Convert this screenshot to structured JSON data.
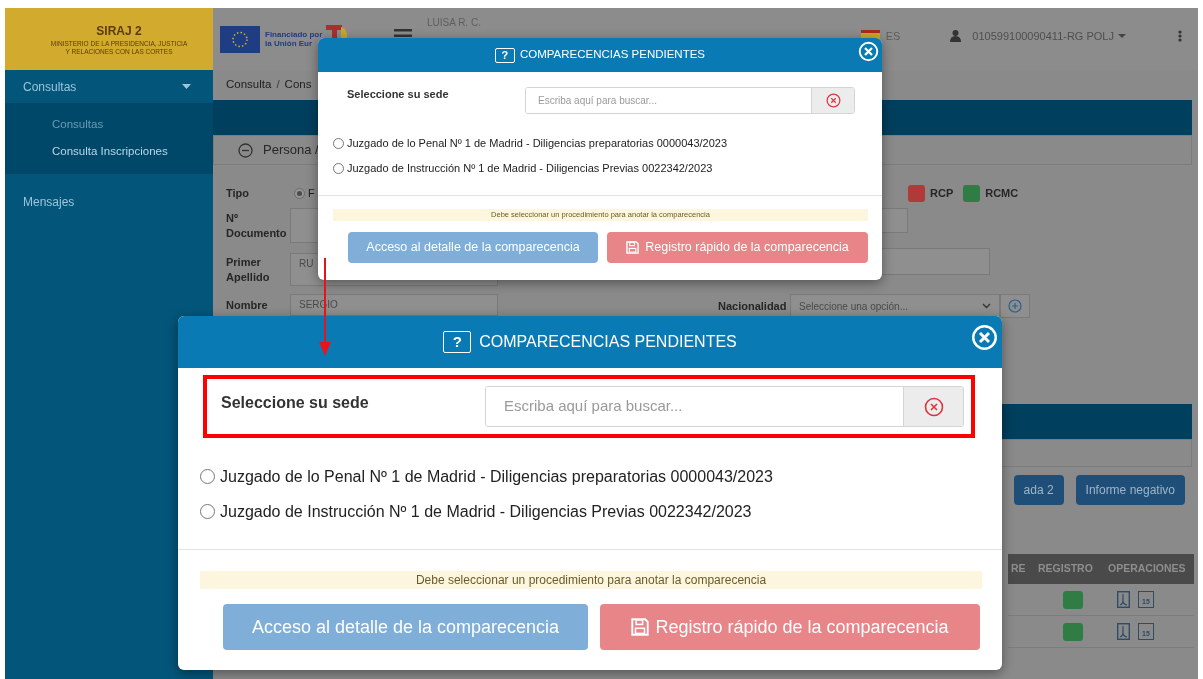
{
  "sidebar": {
    "logo": {
      "title": "SIRAJ 2",
      "lines": [
        "MINISTERIO DE LA PRESIDENCIA, JUSTICIA",
        "Y RELACIONES CON LAS CORTES"
      ]
    },
    "menu": [
      {
        "label": "Consultas",
        "expanded": true,
        "children": [
          {
            "label": "Consultas",
            "selected": false
          },
          {
            "label": "Consulta Inscripciones",
            "selected": true
          }
        ]
      },
      {
        "label": "Mensajes"
      }
    ]
  },
  "header": {
    "funding": [
      "Financiado por",
      "la Unión Eur"
    ],
    "user_name": "LUISA R. C.",
    "language": "ES",
    "account": "010599100090411-RG POLJ"
  },
  "breadcrumb": {
    "items": [
      "Consulta",
      "Cons"
    ],
    "separator": "/"
  },
  "section": {
    "title": "Persona /",
    "expanded": true
  },
  "form": {
    "type": {
      "label": "Tipo",
      "option": "F",
      "selected": true
    },
    "fields": [
      {
        "label": "Nº Documento"
      },
      {
        "label": "Primer Apellido",
        "value": "RU"
      },
      {
        "label": "Nombre",
        "value": "SERGIO"
      }
    ],
    "legend": [
      {
        "label": "RCP",
        "color": "#b03a3a"
      },
      {
        "label": "RCMC",
        "color": "#2f7d45"
      }
    ],
    "nationality": {
      "label": "Nacionalidad",
      "placeholder": "Seleccione una opción..."
    }
  },
  "actions": [
    "ada 2",
    "Informe negativo"
  ],
  "table": {
    "columns": [
      "RE",
      "REGISTRO",
      "OPERACIONES"
    ],
    "rows": [
      {
        "registered": true,
        "calendar_day": "15"
      },
      {
        "registered": true,
        "calendar_day": "15"
      }
    ]
  },
  "dialogs": [
    {
      "kind": "original",
      "title_icon": "?",
      "title": "COMPARECENCIAS PENDIENTES",
      "sede_label": "Seleccione su sede",
      "sede_highlighted": false,
      "search": {
        "placeholder": "Escriba aquí para buscar..."
      },
      "options": [
        {
          "label": "Juzgado de lo Penal Nº 1 de Madrid - Diligencias preparatorias 0000043/2023",
          "selected": false
        },
        {
          "label": "Juzgado de Instrucción Nº 1 de Madrid - Diligencias Previas 0022342/2023",
          "selected": false
        }
      ],
      "notice": "Debe seleccionar un procedimiento para anotar la comparecencia",
      "buttons": [
        {
          "label": "Acceso al detalle de la comparecencia",
          "kind": "primary",
          "disabled": true
        },
        {
          "label": "Registro rápido de la comparecencia",
          "kind": "danger",
          "disabled": true
        }
      ]
    },
    {
      "kind": "enlarged",
      "title_icon": "?",
      "title": "COMPARECENCIAS PENDIENTES",
      "sede_label": "Seleccione su sede",
      "sede_highlighted": true,
      "search": {
        "placeholder": "Escriba aquí para buscar..."
      },
      "options": [
        {
          "label": "Juzgado de lo Penal Nº 1 de Madrid - Diligencias preparatorias 0000043/2023",
          "selected": false
        },
        {
          "label": "Juzgado de Instrucción Nº 1 de Madrid - Diligencias Previas 0022342/2023",
          "selected": false
        }
      ],
      "notice": "Debe seleccionar un procedimiento para anotar la comparecencia",
      "buttons": [
        {
          "label": "Acceso al detalle de la comparecencia",
          "kind": "primary",
          "disabled": true
        },
        {
          "label": "Registro rápido de la comparecencia",
          "kind": "danger",
          "disabled": true
        }
      ]
    }
  ]
}
